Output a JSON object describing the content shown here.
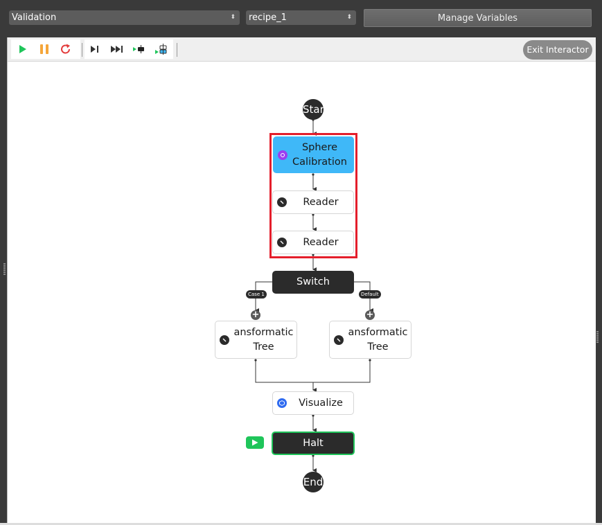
{
  "header": {
    "process_select": {
      "value": "Validation"
    },
    "recipe_select": {
      "value": "recipe_1"
    },
    "manage_variables_label": "Manage Variables"
  },
  "toolbar": {
    "buttons": [
      {
        "name": "run",
        "icon": "play-icon",
        "color": "#1fc55a"
      },
      {
        "name": "pause",
        "icon": "pause-icon",
        "color": "#f5a63a"
      },
      {
        "name": "restart",
        "icon": "restart-icon",
        "color": "#e33b3b"
      },
      {
        "name": "step",
        "icon": "step-icon"
      },
      {
        "name": "step-over",
        "icon": "fast-forward-icon"
      },
      {
        "name": "run-to-node",
        "icon": "run-to-node-icon"
      },
      {
        "name": "run-to-selection",
        "icon": "run-to-selection-icon"
      }
    ],
    "exit_label": "Exit Interactor"
  },
  "flow": {
    "start_label": "Start",
    "end_label": "End",
    "nodes": [
      {
        "id": "sphere-calibration",
        "label_line1": "Sphere",
        "label_line2": "Calibration",
        "icon": "target-icon",
        "icon_color": "#9b3ff0",
        "state": "selected"
      },
      {
        "id": "reader-1",
        "label": "Reader",
        "icon": "wrench-icon"
      },
      {
        "id": "reader-2",
        "label": "Reader",
        "icon": "wrench-icon"
      },
      {
        "id": "switch",
        "label": "Switch"
      },
      {
        "id": "transformation-tree-1",
        "label_line1": "ansformatic",
        "label_line2": "Tree",
        "icon": "wrench-icon"
      },
      {
        "id": "transformation-tree-2",
        "label_line1": "ansformatic",
        "label_line2": "Tree",
        "icon": "wrench-icon"
      },
      {
        "id": "visualize",
        "label": "Visualize",
        "icon": "cube-icon",
        "icon_color": "#2f6bf0"
      },
      {
        "id": "halt",
        "label": "Halt",
        "state": "current"
      }
    ],
    "switch_cases": [
      "Case 1",
      "Default"
    ],
    "colors": {
      "selected_node": "#3fb8f8",
      "selection_box": "#e41e2b",
      "current_node_border": "#1fc55a",
      "dark_node": "#2b2b2b"
    }
  }
}
